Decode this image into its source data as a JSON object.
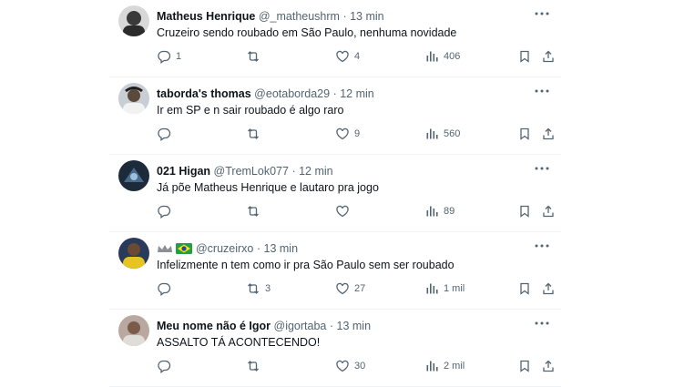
{
  "tweets": [
    {
      "name": "Matheus Henrique",
      "handle": "@_matheushrm",
      "sep": "·",
      "time": "13 min",
      "text": "Cruzeiro sendo roubado em São Paulo, nenhuma novidade",
      "replies": "1",
      "retweets": "",
      "likes": "4",
      "views": "406",
      "avatar_color": "#3a3a3a"
    },
    {
      "name": "taborda's thomas",
      "handle": "@eotaborda29",
      "sep": "·",
      "time": "12 min",
      "text": "Ir em SP e n sair roubado é algo raro",
      "replies": "",
      "retweets": "",
      "likes": "9",
      "views": "560",
      "avatar_color": "#4a4f56"
    },
    {
      "name": "021 Higan",
      "handle": "@TremLok077",
      "sep": "·",
      "time": "12 min",
      "text": "Já põe Matheus Henrique e lautaro pra jogo",
      "replies": "",
      "retweets": "",
      "likes": "",
      "views": "89",
      "avatar_color": "#1c2a3a"
    },
    {
      "name": "",
      "handle": "@cruzeirxo",
      "sep": "·",
      "time": "13 min",
      "text": "Infelizmente n tem como ir pra São Paulo sem ser roubado",
      "replies": "",
      "retweets": "3",
      "likes": "27",
      "views": "1 mil",
      "avatar_color": "#d4b21c"
    },
    {
      "name": "Meu nome não é Igor",
      "handle": "@igortaba",
      "sep": "·",
      "time": "13 min",
      "text": "ASSALTO TÁ ACONTECENDO!",
      "replies": "",
      "retweets": "",
      "likes": "30",
      "views": "2 mil",
      "avatar_color": "#8a7a70"
    }
  ],
  "icons": {
    "reply": "reply-icon",
    "retweet": "retweet-icon",
    "like": "heart-icon",
    "views": "views-icon",
    "bookmark": "bookmark-icon",
    "share": "share-icon",
    "more": "more-icon"
  },
  "colors": {
    "text": "#0f1419",
    "muted": "#536471",
    "divider": "#eff3f4"
  }
}
